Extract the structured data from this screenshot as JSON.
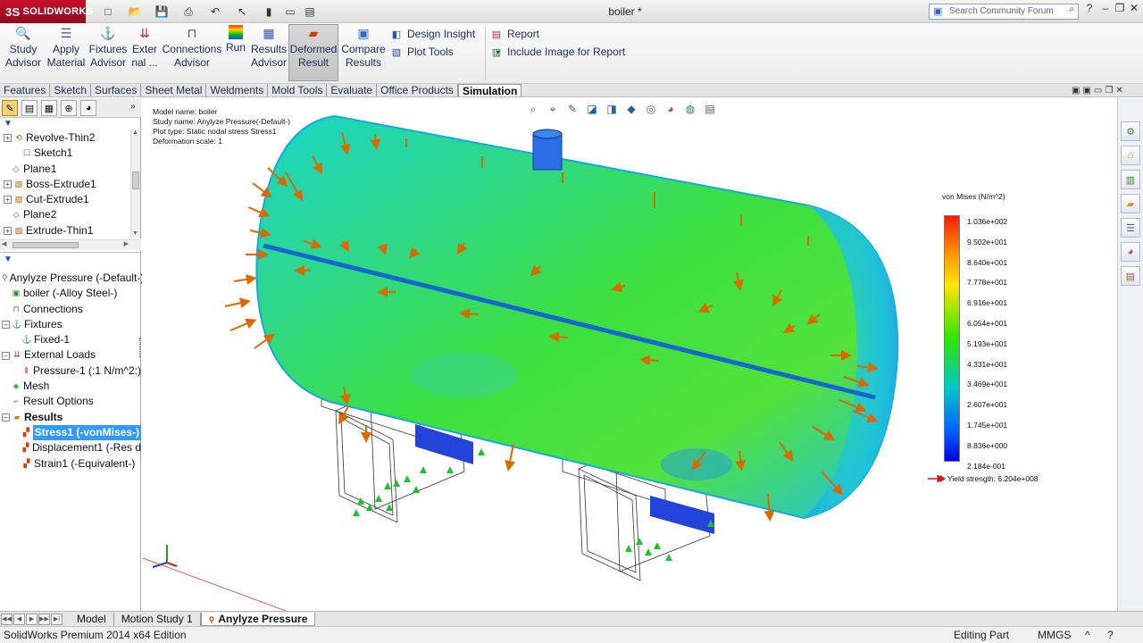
{
  "app": {
    "brand": "SOLIDWORKS",
    "document_title": "boiler *",
    "search_placeholder": "Search Community Forum"
  },
  "ribbon": {
    "study_advisor": [
      "Study",
      "Advisor"
    ],
    "apply_material": [
      "Apply",
      "Material"
    ],
    "fixtures_advisor": [
      "Fixtures",
      "Advisor"
    ],
    "external_loads": [
      "Exter",
      "nal ..."
    ],
    "connections_advisor": [
      "Connections",
      "Advisor"
    ],
    "run": "Run",
    "results_advisor": [
      "Results",
      "Advisor"
    ],
    "deformed_result": [
      "Deformed",
      "Result"
    ],
    "compare_results": [
      "Compare",
      "Results"
    ],
    "design_insight": "Design Insight",
    "plot_tools": "Plot Tools",
    "report": "Report",
    "include_image": "Include Image for Report"
  },
  "tabs": [
    "Features",
    "Sketch",
    "Surfaces",
    "Sheet Metal",
    "Weldments",
    "Mold Tools",
    "Evaluate",
    "Office Products",
    "Simulation"
  ],
  "active_tab": "Simulation",
  "feature_tree": [
    "Revolve-Thin2",
    "Sketch1",
    "Plane1",
    "Boss-Extrude1",
    "Cut-Extrude1",
    "Plane2",
    "Extrude-Thin1"
  ],
  "study_tree": {
    "study": "Anylyze Pressure (-Default-)",
    "part": "boiler (-Alloy Steel-)",
    "connections": "Connections",
    "fixtures": "Fixtures",
    "fixed": "Fixed-1",
    "external_loads": "External Loads",
    "pressure": "Pressure-1 (:1 N/m^2:)",
    "mesh": "Mesh",
    "result_options": "Result Options",
    "results": "Results",
    "stress": "Stress1 (-vonMises-)",
    "displacement": "Displacement1 (-Res d",
    "strain": "Strain1 (-Equivalent-)"
  },
  "plot_info": {
    "model_name": "Model name: boiler",
    "study_name": "Study name: Anylyze Pressure(-Default-)",
    "plot_type": "Plot type: Static nodal stress Stress1",
    "deformation_scale": "Deformation scale: 1"
  },
  "legend": {
    "title": "von Mises (N/m^2)",
    "values": [
      "1.036e+002",
      "9.502e+001",
      "8.640e+001",
      "7.778e+001",
      "6.916e+001",
      "6.054e+001",
      "5.193e+001",
      "4.331e+001",
      "3.469e+001",
      "2.607e+001",
      "1.745e+001",
      "8.836e+000",
      "2.184e-001"
    ],
    "yield_strength": "Yield strength: 6.204e+008",
    "colors": [
      "#ff1a00",
      "#ff8c00",
      "#ffe600",
      "#2ee600",
      "#00c8c8",
      "#0060ff",
      "#0000dd"
    ]
  },
  "bottom_tabs": [
    "Model",
    "Motion Study 1",
    "Anylyze Pressure"
  ],
  "active_bottom_tab": "Anylyze Pressure",
  "status": {
    "edition": "SolidWorks Premium 2014 x64 Edition",
    "mode": "Editing Part",
    "units": "MMGS",
    "caret": "^",
    "help": "?"
  }
}
